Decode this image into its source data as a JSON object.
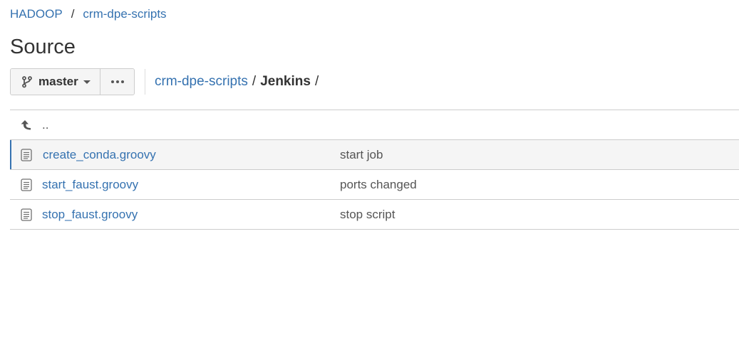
{
  "breadcrumb": {
    "project": "HADOOP",
    "separator": "/",
    "repo": "crm-dpe-scripts"
  },
  "page": {
    "title": "Source"
  },
  "toolbar": {
    "branch": "master",
    "path": {
      "repo": "crm-dpe-scripts",
      "separator": "/",
      "current": "Jenkins",
      "trailing": "/"
    }
  },
  "files": {
    "parent": {
      "label": ".."
    },
    "rows": [
      {
        "name": "create_conda.groovy",
        "message": "start job"
      },
      {
        "name": "start_faust.groovy",
        "message": "ports changed"
      },
      {
        "name": "stop_faust.groovy",
        "message": "stop script"
      }
    ]
  },
  "colors": {
    "link": "#3572b0",
    "text": "#333333",
    "muted": "#555555",
    "border": "#cccccc",
    "row_hover": "#f5f5f5"
  },
  "icons": {
    "branch": "git-branch-icon",
    "more": "more-dots-icon",
    "parent": "up-arrow-icon",
    "file": "file-text-icon"
  }
}
